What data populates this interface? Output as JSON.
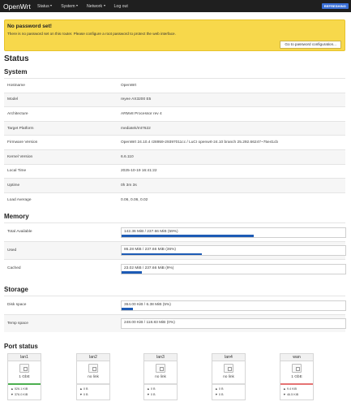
{
  "navbar": {
    "brand": "OpenWrt",
    "menu": [
      "Status",
      "System",
      "Network",
      "Log out"
    ],
    "badge": "REFRESHING"
  },
  "alert": {
    "title": "No password set!",
    "text": "There is no password set on this router. Please configure a root password to protect the web interface.",
    "button": "Go to password configuration..."
  },
  "page_title": "Status",
  "system": {
    "heading": "System",
    "rows": [
      {
        "label": "Hostname",
        "value": "OpenWrt"
      },
      {
        "label": "Model",
        "value": "reyee AX3200 E5"
      },
      {
        "label": "Architecture",
        "value": "ARMv8 Processor rev 4"
      },
      {
        "label": "Target Platform",
        "value": "mediatek/mt7622"
      },
      {
        "label": "Firmware Version",
        "value": "OpenWrt 24.10.4 r28959-29397011cc / LuCI openwrt-24.10 branch 25.292.66247~75e41cb"
      },
      {
        "label": "Kernel Version",
        "value": "6.6.110"
      },
      {
        "label": "Local Time",
        "value": "2025-10-19 16:41:22"
      },
      {
        "label": "Uptime",
        "value": "0h 3m 3s"
      },
      {
        "label": "Load Average",
        "value": "0.06, 0.06, 0.02"
      }
    ]
  },
  "memory": {
    "heading": "Memory",
    "rows": [
      {
        "label": "Total Available",
        "value": "142.36 MiB / 237.66 MiB (59%)",
        "fraction": 0.59
      },
      {
        "label": "Used",
        "value": "86.28 MiB / 237.66 MiB (36%)",
        "fraction": 0.36
      },
      {
        "label": "Cached",
        "value": "23.02 MiB / 237.66 MiB (9%)",
        "fraction": 0.09
      }
    ]
  },
  "storage": {
    "heading": "Storage",
    "rows": [
      {
        "label": "Disk space",
        "value": "364.00 KiB / 6.38 MiB (5%)",
        "fraction": 0.05
      },
      {
        "label": "Temp space",
        "value": "248.00 KiB / 118.83 MiB (0%)",
        "fraction": 0.0
      }
    ]
  },
  "ports": {
    "heading": "Port status",
    "items": [
      {
        "name": "lan1",
        "speed": "1 GbE",
        "up": true,
        "rx": "▲ 526.1 KiB",
        "tx": "▼ 376.0 KiB",
        "color": "#4caf50"
      },
      {
        "name": "lan2",
        "speed": "no link",
        "up": false,
        "rx": "▲ 0 B",
        "tx": "▼ 0 B",
        "color": "#dcdcdc"
      },
      {
        "name": "lan3",
        "speed": "no link",
        "up": false,
        "rx": "▲ 0 B",
        "tx": "▼ 0 B",
        "color": "#dcdcdc"
      },
      {
        "name": "lan4",
        "speed": "no link",
        "up": false,
        "rx": "▲ 0 B",
        "tx": "▼ 0 B",
        "color": "#dcdcdc"
      },
      {
        "name": "wan",
        "speed": "1 GbE",
        "up": true,
        "rx": "▲ 9.4 KiB",
        "tx": "▼ 46.5 KiB",
        "color": "#e57373"
      }
    ]
  },
  "colors": {
    "bar": "#1d5bb5",
    "alert_bg": "#f7d84b",
    "navbar": "#1f1f1f"
  }
}
